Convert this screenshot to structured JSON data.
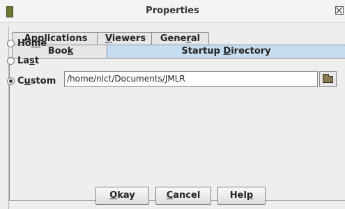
{
  "window": {
    "title": "Properties"
  },
  "tabs": {
    "row1": [
      {
        "label": "Applications"
      },
      {
        "label": "Viewers"
      },
      {
        "label": "General"
      }
    ],
    "row2": [
      {
        "label": "Book"
      },
      {
        "label": "Startup Directory",
        "selected": true
      }
    ]
  },
  "startup": {
    "options": [
      {
        "label": "Home",
        "selected": false
      },
      {
        "label": "Last",
        "selected": false
      },
      {
        "label": "Custom",
        "selected": true
      }
    ],
    "custom_path": "/home/nlct/Documents/JMLR"
  },
  "buttons": {
    "okay": "Okay",
    "cancel": "Cancel",
    "help": "Help"
  },
  "icons": {
    "app": "book-icon",
    "close": "close-icon",
    "browse": "folder-icon"
  },
  "colors": {
    "selected_tab": "#c6dcef"
  }
}
